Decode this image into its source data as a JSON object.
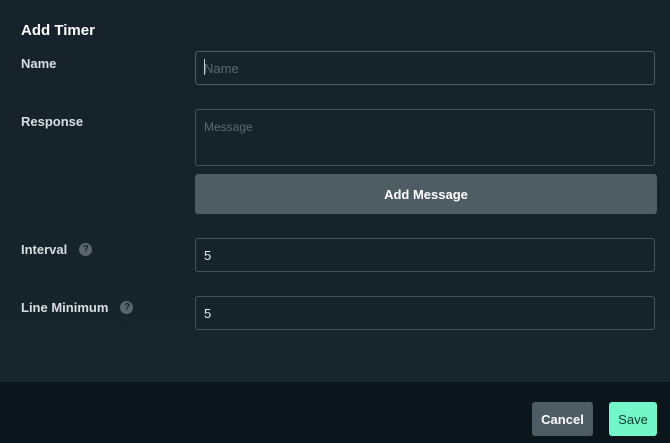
{
  "dialog": {
    "title": "Add Timer"
  },
  "form": {
    "name": {
      "label": "Name",
      "value": "",
      "placeholder": "Name"
    },
    "response": {
      "label": "Response",
      "value": "",
      "placeholder": "Message",
      "add_button_label": "Add Message"
    },
    "interval": {
      "label": "Interval",
      "value": "5",
      "help_icon": "question-circle-icon"
    },
    "line_minimum": {
      "label": "Line Minimum",
      "value": "5",
      "help_icon": "question-circle-icon"
    }
  },
  "footer": {
    "cancel_label": "Cancel",
    "save_label": "Save"
  },
  "colors": {
    "background": "#17232b",
    "footer_background": "#0a151c",
    "secondary_button": "#4e5c63",
    "accent": "#73f7c9"
  }
}
